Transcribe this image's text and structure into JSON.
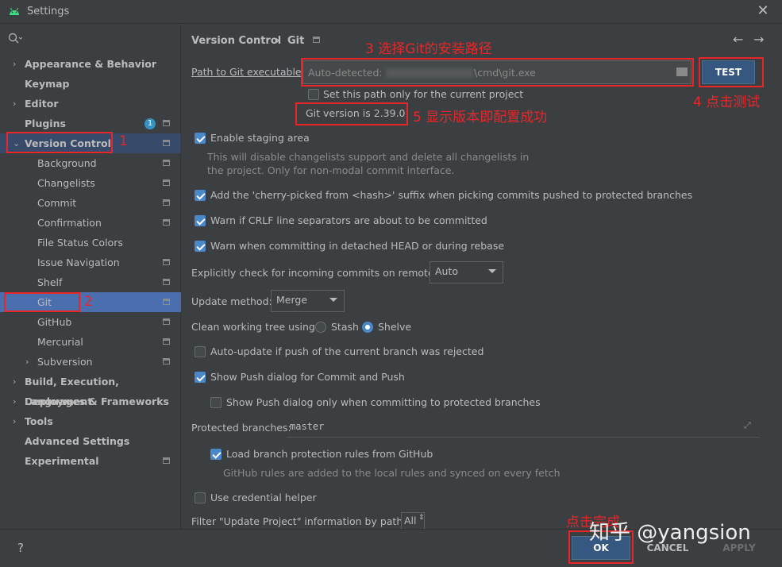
{
  "window": {
    "title": "Settings"
  },
  "search": {
    "icon": "search-icon"
  },
  "sidebar": {
    "items": [
      {
        "label": "Appearance & Behavior",
        "bold": true,
        "arrow": "›"
      },
      {
        "label": "Keymap",
        "bold": true
      },
      {
        "label": "Editor",
        "bold": true,
        "arrow": "›"
      },
      {
        "label": "Plugins",
        "bold": true,
        "badge": "1"
      },
      {
        "label": "Version Control",
        "bold": true,
        "arrow": "⌄"
      },
      {
        "label": "Background"
      },
      {
        "label": "Changelists"
      },
      {
        "label": "Commit"
      },
      {
        "label": "Confirmation"
      },
      {
        "label": "File Status Colors"
      },
      {
        "label": "Issue Navigation"
      },
      {
        "label": "Shelf"
      },
      {
        "label": "Git"
      },
      {
        "label": "GitHub"
      },
      {
        "label": "Mercurial"
      },
      {
        "label": "Subversion",
        "arrow": "›"
      },
      {
        "label": "Build, Execution, Deployment",
        "bold": true,
        "arrow": "›"
      },
      {
        "label": "Languages & Frameworks",
        "bold": true,
        "arrow": "›"
      },
      {
        "label": "Tools",
        "bold": true,
        "arrow": "›"
      },
      {
        "label": "Advanced Settings",
        "bold": true
      },
      {
        "label": "Experimental",
        "bold": true
      }
    ]
  },
  "breadcrumb": {
    "parent": "Version Control",
    "sep": "›",
    "current": "Git",
    "back": "←",
    "forward": "→"
  },
  "git": {
    "path_label": "Path to Git executable:",
    "path_value": "Auto-detected: ",
    "path_value_masked": "\\cmd\\git.exe",
    "test_button": "TEST",
    "only_current_project": "Set this path only for the current project",
    "version_text": "Git version is 2.39.0",
    "staging_label": "Enable staging area",
    "staging_hint_1": "This will disable changelists support and delete all changelists in",
    "staging_hint_2": "the project. Only for non-modal commit interface.",
    "cherry_pick_label": "Add the 'cherry-picked from <hash>' suffix when picking commits pushed to protected branches",
    "crlf_label": "Warn if CRLF line separators are about to be committed",
    "detached_label": "Warn when committing in detached HEAD or during rebase",
    "incoming_label": "Explicitly check for incoming commits on remotes:",
    "incoming_value": "Auto",
    "update_method_label": "Update method:",
    "update_method_value": "Merge",
    "clean_tree_label": "Clean working tree using:",
    "stash_label": "Stash",
    "shelve_label": "Shelve",
    "auto_update_label": "Auto-update if push of the current branch was rejected",
    "show_push_label": "Show Push dialog for Commit and Push",
    "show_push_protected_label": "Show Push dialog only when committing to protected branches",
    "protected_label": "Protected branches:",
    "protected_value": "master",
    "load_rules_label": "Load branch protection rules from GitHub",
    "load_rules_hint": "GitHub rules are added to the local rules and synced on every fetch",
    "credential_label": "Use credential helper",
    "filter_label": "Filter \"Update Project\" information by paths:",
    "filter_value": "All"
  },
  "annotations": {
    "a1": "1",
    "a2": "2",
    "a3": "3 选择Git的安装路径",
    "a4": "4 点击测试",
    "a5": "5 显示版本即配置成功",
    "a6": "点击完成"
  },
  "footer": {
    "help": "?",
    "ok": "OK",
    "cancel": "CANCEL",
    "apply": "APPLY"
  },
  "watermark": "知乎 @yangsion",
  "colors": {
    "accent": "#4b6eaf",
    "annotation": "#e8262a",
    "background": "#3c3f41"
  }
}
